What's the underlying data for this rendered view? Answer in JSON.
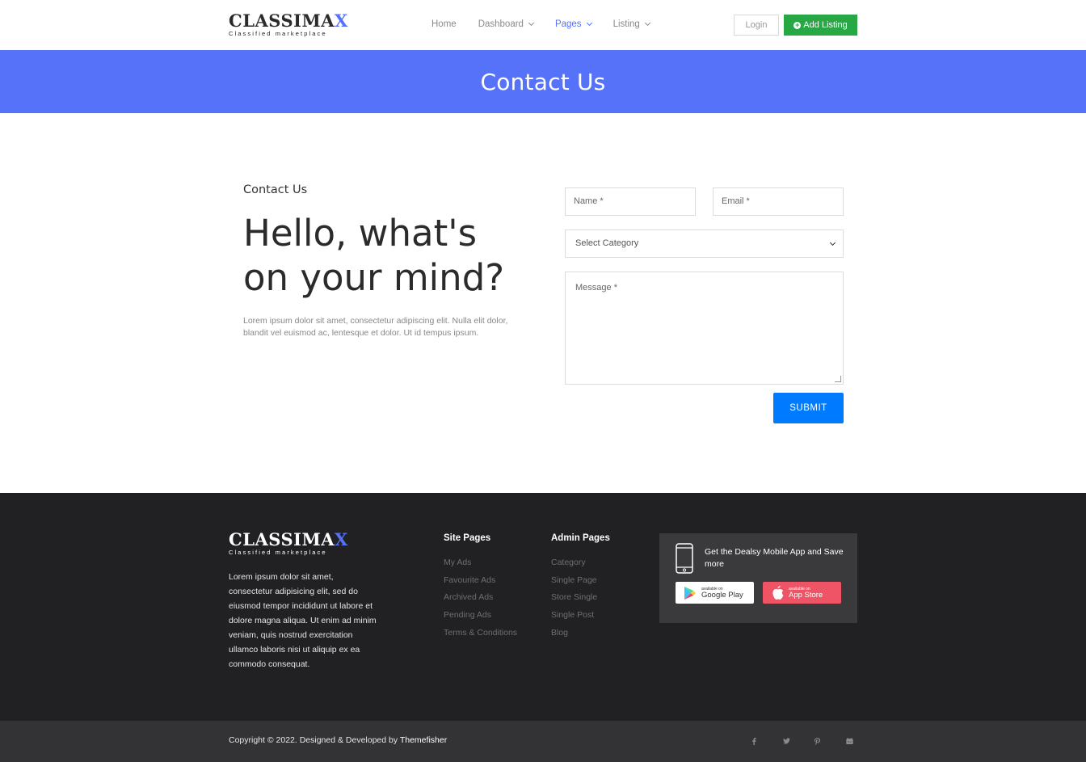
{
  "header": {
    "logo_main": "CLASSIMA",
    "logo_accent": "X",
    "logo_tagline": "Classified marketplace",
    "nav": [
      {
        "label": "Home",
        "dropdown": false,
        "active": false
      },
      {
        "label": "Dashboard",
        "dropdown": true,
        "active": false
      },
      {
        "label": "Pages",
        "dropdown": true,
        "active": true
      },
      {
        "label": "Listing",
        "dropdown": true,
        "active": false
      }
    ],
    "login_label": "Login",
    "add_listing_label": "Add Listing"
  },
  "banner": {
    "title": "Contact Us",
    "color": "#5672f9"
  },
  "contact": {
    "kicker": "Contact Us",
    "heading_line1": "Hello, what's",
    "heading_line2": "on your mind?",
    "description": "Lorem ipsum dolor sit amet, consectetur adipiscing elit. Nulla elit dolor, blandit vel euismod ac, lentesque et dolor. Ut id tempus ipsum."
  },
  "form": {
    "name_placeholder": "Name *",
    "email_placeholder": "Email *",
    "category_selected": "Select Category",
    "message_placeholder": "Message *",
    "submit_label": "SUBMIT",
    "submit_color": "#007bff"
  },
  "footer": {
    "logo_main": "CLASSIMA",
    "logo_accent": "X",
    "logo_tagline": "Classified marketplace",
    "about": "Lorem ipsum dolor sit amet, consectetur adipisicing elit, sed do eiusmod tempor incididunt ut labore et dolore magna aliqua. Ut enim ad minim veniam, quis nostrud exercitation ullamco laboris nisi ut aliquip ex ea commodo consequat.",
    "site_pages": {
      "title": "Site Pages",
      "links": [
        "My Ads",
        "Favourite Ads",
        "Archived Ads",
        "Pending Ads",
        "Terms & Conditions"
      ]
    },
    "admin_pages": {
      "title": "Admin Pages",
      "links": [
        "Category",
        "Single Page",
        "Store Single",
        "Single Post",
        "Blog"
      ]
    },
    "app": {
      "text": "Get the Dealsy Mobile App and Save more",
      "google_small": "available on",
      "google_big": "Google Play",
      "apple_small": "available on",
      "apple_big": "App Store"
    },
    "copyright_prefix": "Copyright © 2022. Designed & Developed by ",
    "copyright_brand": "Themefisher",
    "socials": [
      "facebook-icon",
      "twitter-icon",
      "pinterest-icon",
      "github-icon"
    ]
  }
}
